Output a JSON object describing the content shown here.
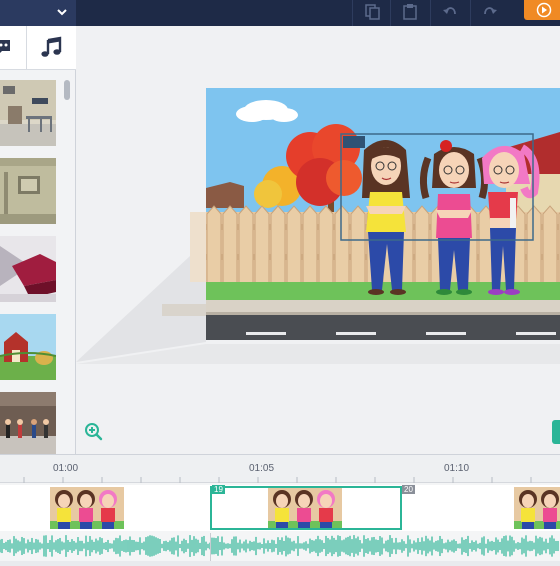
{
  "toolbar": {
    "scene_menu_icon": "chevron-down-icon",
    "buttons": [
      "copy-icon",
      "paste-icon",
      "undo-icon",
      "redo-icon"
    ],
    "preview_icon": "play-icon",
    "colors": {
      "bar": "#1e2a47",
      "accent": "#f08a24"
    }
  },
  "library": {
    "tabs": [
      "speech-bubble-icon",
      "music-note-icon"
    ],
    "thumbnails": [
      "office-lobby",
      "room-interior",
      "modern-room",
      "farm-red-barn",
      "school-hallway"
    ]
  },
  "stage": {
    "background": "suburban-street-fence",
    "characters": [
      "girl-yellow-shirt",
      "girl-pink-shirt-pigtails",
      "girl-pink-hair"
    ]
  },
  "timeline": {
    "ticks": [
      "01:00",
      "01:05",
      "01:10"
    ],
    "selected_scene": {
      "start_label": "19",
      "end_label": "20"
    },
    "accent": "#2bb597"
  }
}
